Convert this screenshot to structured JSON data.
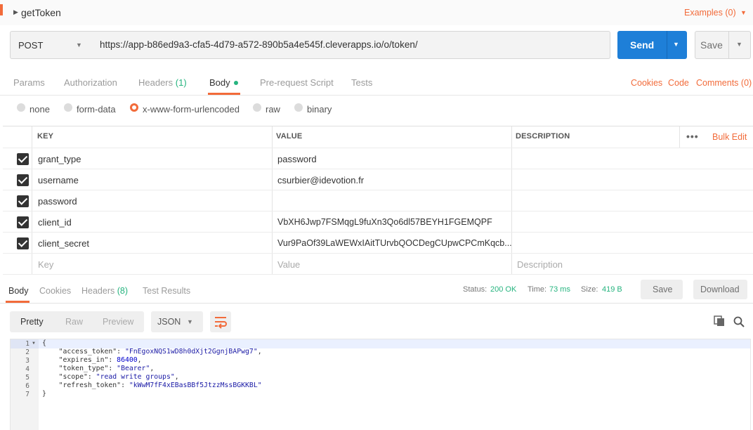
{
  "request": {
    "name": "getToken",
    "examples_label": "Examples (0)",
    "method": "POST",
    "url": "https://app-b86ed9a3-cfa5-4d79-a572-890b5a4e545f.cleverapps.io/o/token/",
    "send_label": "Send",
    "save_label": "Save"
  },
  "request_tabs": {
    "params": "Params",
    "authorization": "Authorization",
    "headers": "Headers",
    "headers_count": "(1)",
    "body": "Body",
    "prerequest": "Pre-request Script",
    "tests": "Tests",
    "cookies": "Cookies",
    "code": "Code",
    "comments": "Comments (0)"
  },
  "body_types": {
    "none": "none",
    "form_data": "form-data",
    "urlencoded": "x-www-form-urlencoded",
    "raw": "raw",
    "binary": "binary",
    "selected": "x-www-form-urlencoded"
  },
  "table": {
    "headers": {
      "key": "KEY",
      "value": "VALUE",
      "description": "DESCRIPTION"
    },
    "more_label": "•••",
    "bulk_edit": "Bulk Edit",
    "rows": [
      {
        "checked": true,
        "key": "grant_type",
        "value": "password",
        "description": ""
      },
      {
        "checked": true,
        "key": "username",
        "value": "csurbier@idevotion.fr",
        "description": ""
      },
      {
        "checked": true,
        "key": "password",
        "value": "",
        "description": ""
      },
      {
        "checked": true,
        "key": "client_id",
        "value": "VbXH6Jwp7FSMqgL9fuXn3Qo6dl57BEYH1FGEMQPF",
        "description": ""
      },
      {
        "checked": true,
        "key": "client_secret",
        "value": "Vur9PaOf39LaWEWxIAitTUrvbQOCDegCUpwCPCmKqcb...",
        "description": ""
      }
    ],
    "placeholders": {
      "key": "Key",
      "value": "Value",
      "description": "Description"
    }
  },
  "response": {
    "tabs": {
      "body": "Body",
      "cookies": "Cookies",
      "headers": "Headers",
      "headers_count": "(8)",
      "tests": "Test Results"
    },
    "status_label": "Status:",
    "status_value": "200 OK",
    "time_label": "Time:",
    "time_value": "73 ms",
    "size_label": "Size:",
    "size_value": "419 B",
    "save_label": "Save",
    "download_label": "Download",
    "formats": {
      "pretty": "Pretty",
      "raw": "Raw",
      "preview": "Preview"
    },
    "language": "JSON",
    "code_lines": [
      {
        "n": "1",
        "parts": [
          [
            "p",
            "{"
          ]
        ]
      },
      {
        "n": "2",
        "parts": [
          [
            "p",
            "    "
          ],
          [
            "k",
            "\"access_token\""
          ],
          [
            "p",
            ": "
          ],
          [
            "s",
            "\"FnEgoxNQS1wD8h0dXjt2GgnjBAPwg7\""
          ],
          [
            "p",
            ","
          ]
        ]
      },
      {
        "n": "3",
        "parts": [
          [
            "p",
            "    "
          ],
          [
            "k",
            "\"expires_in\""
          ],
          [
            "p",
            ": "
          ],
          [
            "n",
            "86400"
          ],
          [
            "p",
            ","
          ]
        ]
      },
      {
        "n": "4",
        "parts": [
          [
            "p",
            "    "
          ],
          [
            "k",
            "\"token_type\""
          ],
          [
            "p",
            ": "
          ],
          [
            "s",
            "\"Bearer\""
          ],
          [
            "p",
            ","
          ]
        ]
      },
      {
        "n": "5",
        "parts": [
          [
            "p",
            "    "
          ],
          [
            "k",
            "\"scope\""
          ],
          [
            "p",
            ": "
          ],
          [
            "s",
            "\"read write groups\""
          ],
          [
            "p",
            ","
          ]
        ]
      },
      {
        "n": "6",
        "parts": [
          [
            "p",
            "    "
          ],
          [
            "k",
            "\"refresh_token\""
          ],
          [
            "p",
            ": "
          ],
          [
            "s",
            "\"kWwM7fF4xEBasBBf5JtzzMssBGKKBL\""
          ]
        ]
      },
      {
        "n": "7",
        "parts": [
          [
            "p",
            "}"
          ]
        ]
      }
    ]
  },
  "colors": {
    "accent": "#f26b3a",
    "send_blue": "#1e7fd8",
    "success_green": "#26b47f"
  }
}
